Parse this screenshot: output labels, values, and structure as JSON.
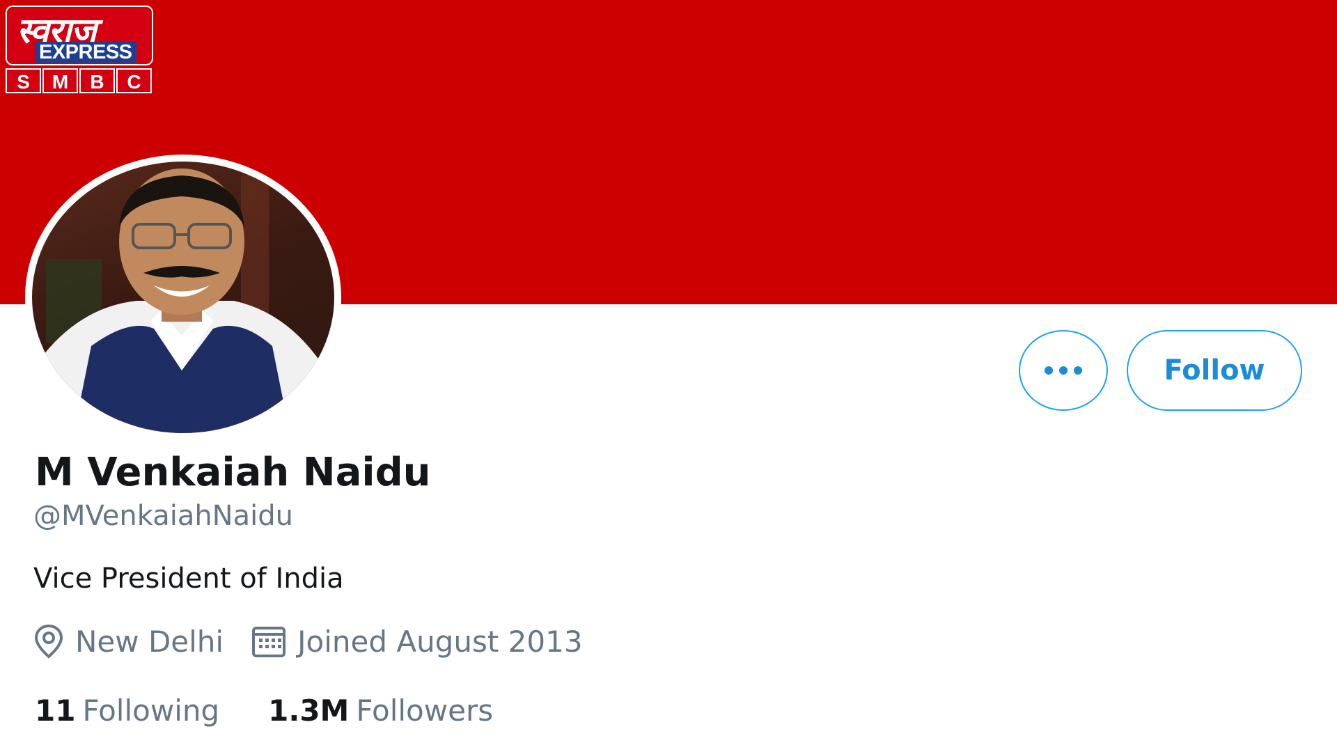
{
  "logo": {
    "hindi_text": "स्वराज",
    "express_text": "EXPRESS",
    "letters": [
      "S",
      "M",
      "B",
      "C"
    ]
  },
  "profile": {
    "name": "M Venkaiah Naidu",
    "handle": "@MVenkaiahNaidu",
    "bio": "Vice President of India",
    "location": "New Delhi",
    "joined": "Joined August 2013",
    "following_count": "11",
    "following_label": "Following",
    "followers_count": "1.3M",
    "followers_label": "Followers"
  },
  "buttons": {
    "follow_label": "Follow"
  },
  "icons": {
    "more": "more-icon",
    "location": "location-pin-icon",
    "calendar": "calendar-icon"
  },
  "colors": {
    "banner": "#cc0000",
    "accent": "#1da1f2",
    "text_primary": "#14171a",
    "text_secondary": "#657786"
  }
}
